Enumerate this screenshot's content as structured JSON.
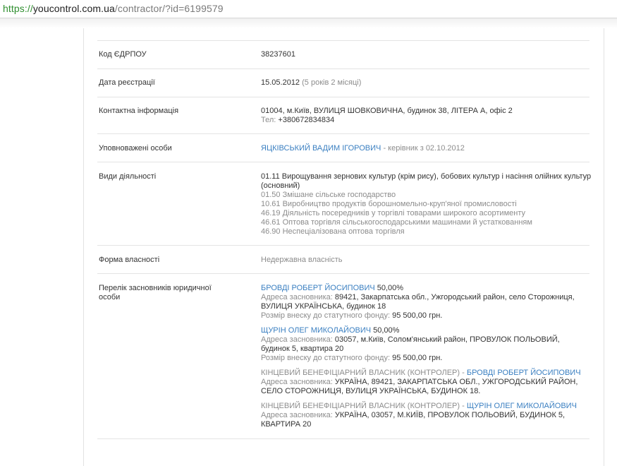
{
  "browser": {
    "url_scheme": "https://",
    "url_host": "youcontrol.com.ua",
    "url_path": "/contractor/?id=6199579"
  },
  "company": {
    "edrpou": {
      "label": "Код ЄДРПОУ",
      "value": "38237601"
    },
    "registration": {
      "label": "Дата реєстрації",
      "date": "15.05.2012",
      "age": "(5 років 2 місяці)"
    },
    "contacts": {
      "label": "Контактна інформація",
      "address": "01004, м.Київ, ВУЛИЦЯ ШОВКОВИЧНА, будинок 38, ЛІТЕРА А, офіс 2",
      "phone_label": "Тел:",
      "phone": "+380672834834"
    },
    "authorized": {
      "label": "Уповноважені особи",
      "name": "ЯЦКІВСЬКИЙ ВАДИМ ІГОРОВИЧ",
      "role": "- керівник з 02.10.2012"
    },
    "activities": {
      "label": "Види діяльності",
      "main_line1": "01.11 Вирощування зернових культур (крім рису), бобових культур і насіння олійних культур",
      "main_line2": "(основний)",
      "other": [
        "01.50 Змішане сільське господарство",
        "10.61 Виробництво продуктів борошномельно-круп'яної промисловості",
        "46.19 Діяльність посередників у торгівлі товарами широкого асортименту",
        "46.61 Оптова торгівля сільськогосподарськими машинами й устаткованням",
        "46.90 Неспеціалізована оптова торгівля"
      ]
    },
    "ownership": {
      "label": "Форма власності",
      "value": "Недержавна власність"
    },
    "founders": {
      "label_line1": "Перелік засновників юридичної",
      "label_line2": "особи",
      "address_label": "Адреса засновника:",
      "capital_label": "Розмір внеску до статутного фонду:",
      "list": [
        {
          "name": "БРОВДІ РОБЕРТ ЙОСИПОВИЧ",
          "share": "50,00%",
          "address_line1": "89421, Закарпатська обл., Ужгородський район, село Сторожниця,",
          "address_line2": "ВУЛИЦЯ УКРАЇНСЬКА, будинок 18",
          "capital": "95 500,00 грн."
        },
        {
          "name": "ЩУРІН ОЛЕГ МИКОЛАЙОВИЧ",
          "share": "50,00%",
          "address_line1": "03057, м.Київ, Солом'янський район, ПРОВУЛОК ПОЛЬОВИЙ,",
          "address_line2": "будинок 5, квартира 20",
          "capital": "95 500,00 грн."
        }
      ],
      "beneficiary_label": "КІНЦЕВИЙ БЕНЕФІЦІАРНИЙ ВЛАСНИК (КОНТРОЛЕР) -",
      "beneficiaries": [
        {
          "name": "БРОВДІ РОБЕРТ ЙОСИПОВИЧ",
          "address_line1": "УКРАЇНА, 89421, ЗАКАРПАТСЬКА ОБЛ., УЖГОРОДСЬКИЙ РАЙОН,",
          "address_line2": "СЕЛО СТОРОЖНИЦЯ, ВУЛИЦЯ УКРАЇНСЬКА, БУДИНОК 18."
        },
        {
          "name": "ЩУРІН ОЛЕГ МИКОЛАЙОВИЧ",
          "address_line1": "УКРАЇНА, 03057, М.КИЇВ, ПРОВУЛОК ПОЛЬОВИЙ, БУДИНОК 5,",
          "address_line2": "КВАРТИРА 20"
        }
      ]
    }
  },
  "colors": {
    "link": "#3a7fc1",
    "muted": "#8c8c8c",
    "text": "#333333",
    "url_scheme": "#2f8f2f",
    "divider": "#e4e4e4"
  }
}
